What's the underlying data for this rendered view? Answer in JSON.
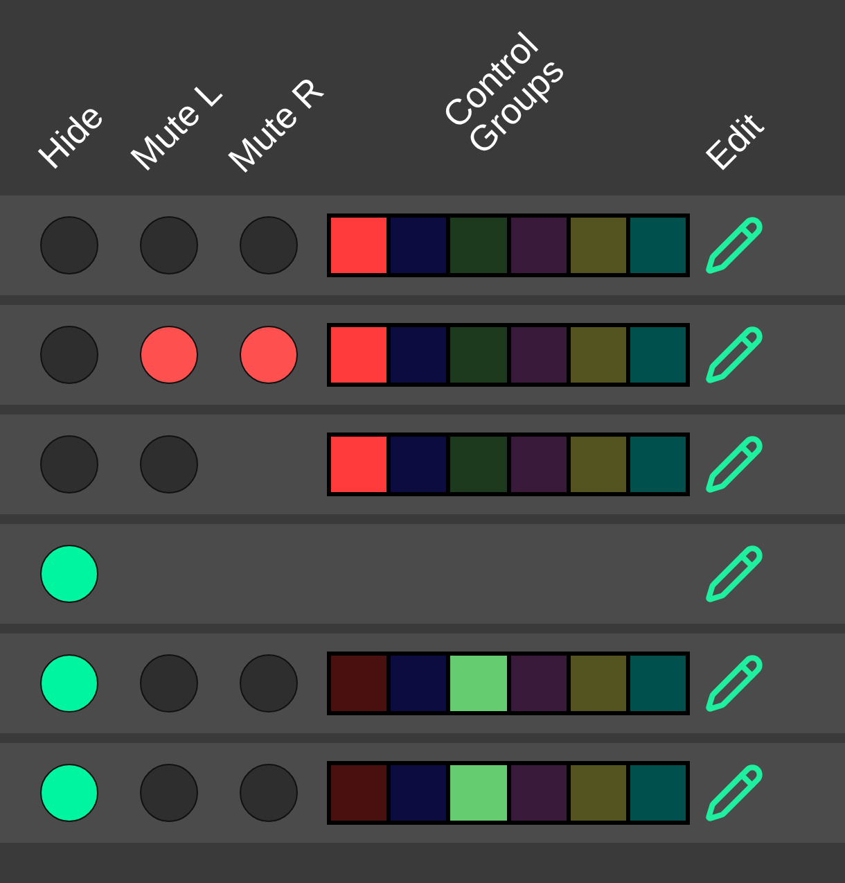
{
  "headers": [
    {
      "label": "Hide"
    },
    {
      "label": "Mute L"
    },
    {
      "label": "Mute R"
    },
    {
      "label": "Control Groups"
    },
    {
      "label": "Edit"
    }
  ],
  "rows": [
    {
      "hide": false,
      "mute_l": false,
      "mute_r": false,
      "groups": [
        {
          "color": "#ff3b3b"
        },
        {
          "color": "#0c0c40"
        },
        {
          "color": "#1e3a1e"
        },
        {
          "color": "#3a1a3a"
        },
        {
          "color": "#545420"
        },
        {
          "color": "#00514e"
        }
      ]
    },
    {
      "hide": false,
      "mute_l": true,
      "mute_r": true,
      "groups": [
        {
          "color": "#ff3b3b"
        },
        {
          "color": "#0c0c40"
        },
        {
          "color": "#1e3a1e"
        },
        {
          "color": "#3a1a3a"
        },
        {
          "color": "#545420"
        },
        {
          "color": "#00514e"
        }
      ]
    },
    {
      "hide": false,
      "mute_l": false,
      "groups": [
        {
          "color": "#ff3b3b"
        },
        {
          "color": "#0c0c40"
        },
        {
          "color": "#1e3a1e"
        },
        {
          "color": "#3a1a3a"
        },
        {
          "color": "#545420"
        },
        {
          "color": "#00514e"
        }
      ]
    },
    {
      "hide": true
    },
    {
      "hide": true,
      "mute_l": false,
      "mute_r": false,
      "groups": [
        {
          "color": "#4a1010"
        },
        {
          "color": "#0c0c40"
        },
        {
          "color": "#66cc70"
        },
        {
          "color": "#3a1a3a"
        },
        {
          "color": "#545420"
        },
        {
          "color": "#00514e"
        }
      ]
    },
    {
      "hide": true,
      "mute_l": false,
      "mute_r": false,
      "groups": [
        {
          "color": "#4a1010"
        },
        {
          "color": "#0c0c40"
        },
        {
          "color": "#66cc70"
        },
        {
          "color": "#3a1a3a"
        },
        {
          "color": "#545420"
        },
        {
          "color": "#00514e"
        }
      ]
    }
  ]
}
